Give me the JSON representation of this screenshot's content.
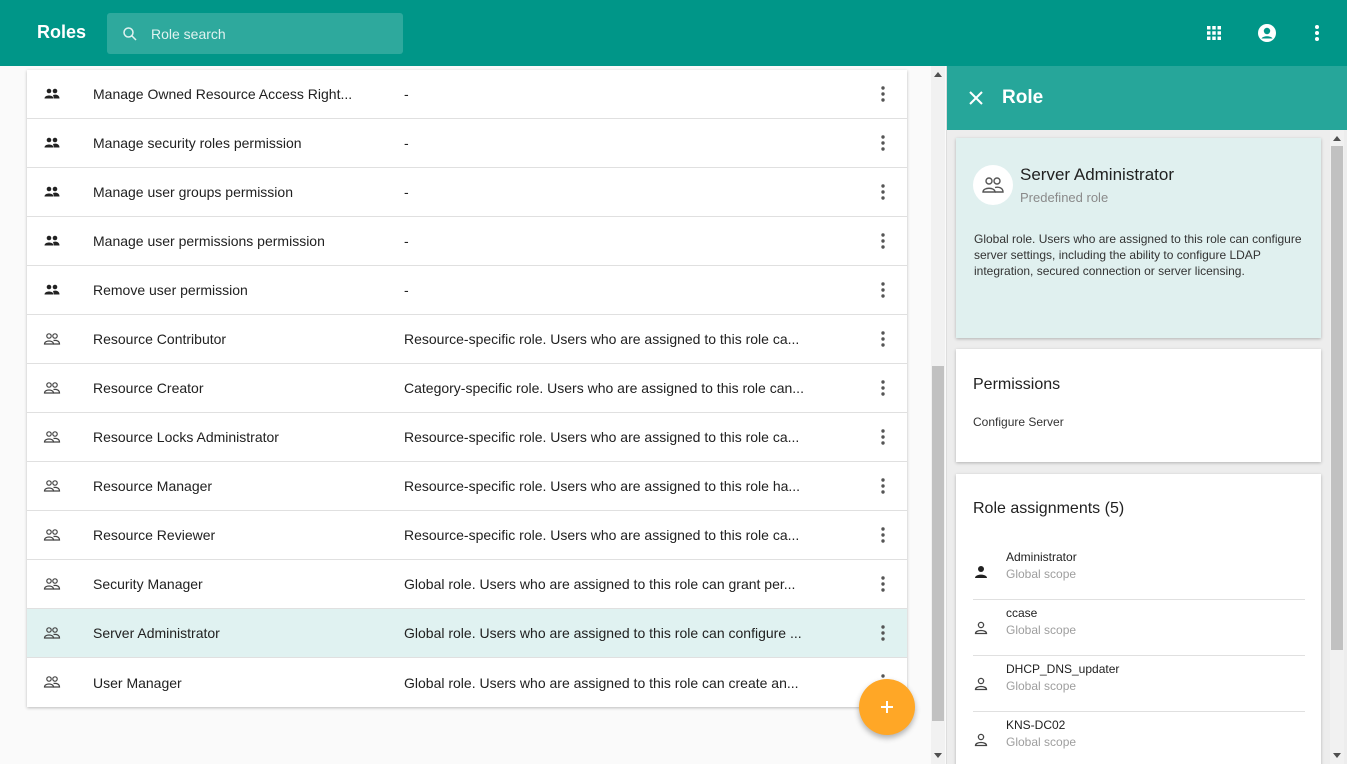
{
  "app": {
    "title": "Roles"
  },
  "search": {
    "placeholder": "Role search"
  },
  "colors": {
    "primary": "#009688",
    "panel_header": "#26a69a",
    "selected_row": "#e0f2f1",
    "fab": "#ffa726"
  },
  "roles": [
    {
      "name": "Manage Owned Resource Access Right...",
      "description": "-",
      "icon": "people-filled-icon"
    },
    {
      "name": "Manage security roles permission",
      "description": "-",
      "icon": "people-filled-icon"
    },
    {
      "name": "Manage user groups permission",
      "description": "-",
      "icon": "people-filled-icon"
    },
    {
      "name": "Manage user permissions permission",
      "description": "-",
      "icon": "people-filled-icon"
    },
    {
      "name": "Remove user permission",
      "description": "-",
      "icon": "people-filled-icon"
    },
    {
      "name": "Resource Contributor",
      "description": "Resource-specific role. Users who are assigned to this role ca...",
      "icon": "people-outline-icon"
    },
    {
      "name": "Resource Creator",
      "description": "Category-specific role. Users who are assigned to this role can...",
      "icon": "people-outline-icon"
    },
    {
      "name": "Resource Locks Administrator",
      "description": "Resource-specific role. Users who are assigned to this role ca...",
      "icon": "people-outline-icon"
    },
    {
      "name": "Resource Manager",
      "description": "Resource-specific role. Users who are assigned to this role ha...",
      "icon": "people-outline-icon"
    },
    {
      "name": "Resource Reviewer",
      "description": "Resource-specific role. Users who are assigned to this role ca...",
      "icon": "people-outline-icon"
    },
    {
      "name": "Security Manager",
      "description": "Global role. Users who are assigned to this role can grant per...",
      "icon": "people-outline-icon"
    },
    {
      "name": "Server Administrator",
      "description": "Global role. Users who are assigned to this role can configure ...",
      "icon": "people-outline-icon",
      "selected": true
    },
    {
      "name": "User Manager",
      "description": "Global role. Users who are assigned to this role can create an...",
      "icon": "people-outline-icon"
    }
  ],
  "panel": {
    "title": "Role",
    "role_name": "Server Administrator",
    "role_type": "Predefined role",
    "description": "Global role. Users who are assigned to this role can configure server settings, including the ability to configure LDAP integration, secured connection or server licensing.",
    "permissions_heading": "Permissions",
    "permissions": [
      "Configure Server"
    ],
    "assignments_heading": "Role assignments (5)",
    "assignments": [
      {
        "name": "Administrator",
        "scope": "Global scope",
        "icon": "person-filled-icon"
      },
      {
        "name": "ccase",
        "scope": "Global scope",
        "icon": "person-outline-icon"
      },
      {
        "name": "DHCP_DNS_updater",
        "scope": "Global scope",
        "icon": "person-outline-icon"
      },
      {
        "name": "KNS-DC02",
        "scope": "Global scope",
        "icon": "person-outline-icon"
      }
    ]
  }
}
